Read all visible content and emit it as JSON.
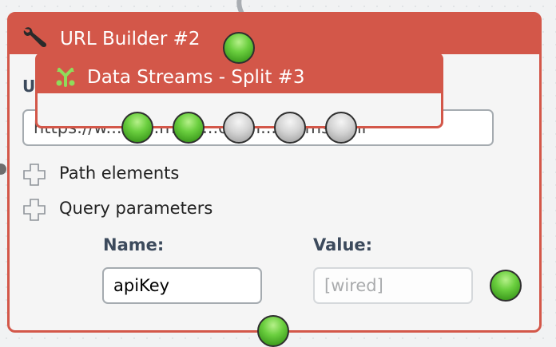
{
  "modules": {
    "url_builder": {
      "title": "URL Builder #2",
      "url_label_fragment": "U",
      "url_value": "https://w...12...m...u...o...m.../forms.xml",
      "sections": [
        {
          "label": "Path elements"
        },
        {
          "label": "Query parameters"
        }
      ],
      "param_headers": {
        "name": "Name:",
        "value": "Value:"
      },
      "param_row": {
        "name_value": "apiKey",
        "value_placeholder": "[wired]"
      }
    },
    "split": {
      "title": "Data Streams - Split #3"
    }
  },
  "icons": {
    "wrench": "wrench-icon",
    "split": "split-icon",
    "plus": "plus-icon"
  },
  "colors": {
    "module_border": "#d35749",
    "terminal_connected": "#6bcf3f",
    "terminal_empty": "#bdbdbd"
  }
}
